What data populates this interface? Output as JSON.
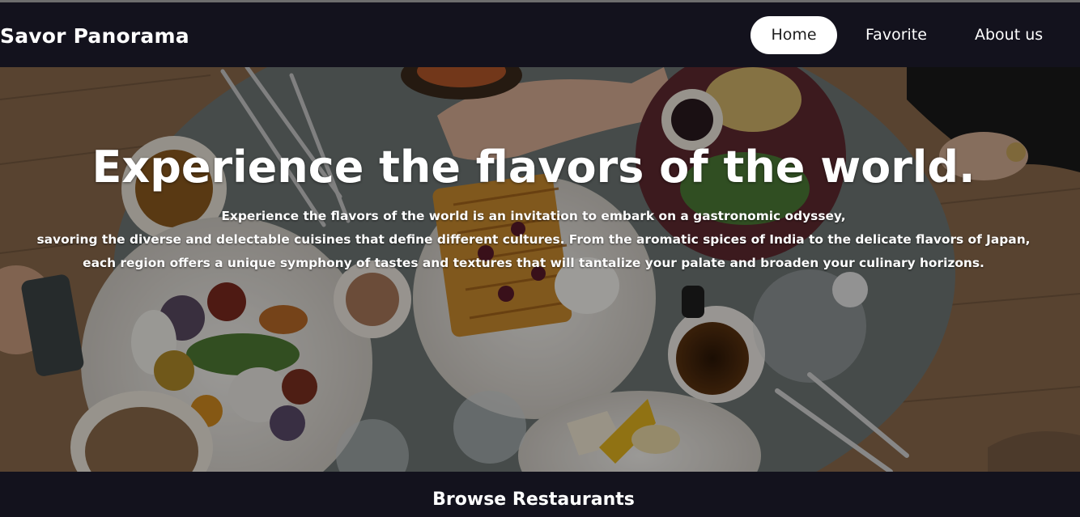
{
  "nav": {
    "brand": "Savor Panorama",
    "links": [
      {
        "label": "Home",
        "active": true
      },
      {
        "label": "Favorite",
        "active": false
      },
      {
        "label": "About us",
        "active": false
      }
    ]
  },
  "hero": {
    "title": "Experience the flavors of the world.",
    "body_lines": [
      "Experience the flavors of the world is an invitation to embark on a gastronomic odyssey,",
      "savoring the diverse and delectable cuisines that define different cultures. From the aromatic spices of India to the delicate flavors of Japan,",
      "each region offers a unique symphony of tastes and textures that will tantalize your palate and broaden your culinary horizons."
    ]
  },
  "browse": {
    "title": "Browse Restaurants"
  },
  "colors": {
    "nav_background": "#13121d",
    "active_pill": "#ffffff",
    "text": "#ffffff"
  }
}
